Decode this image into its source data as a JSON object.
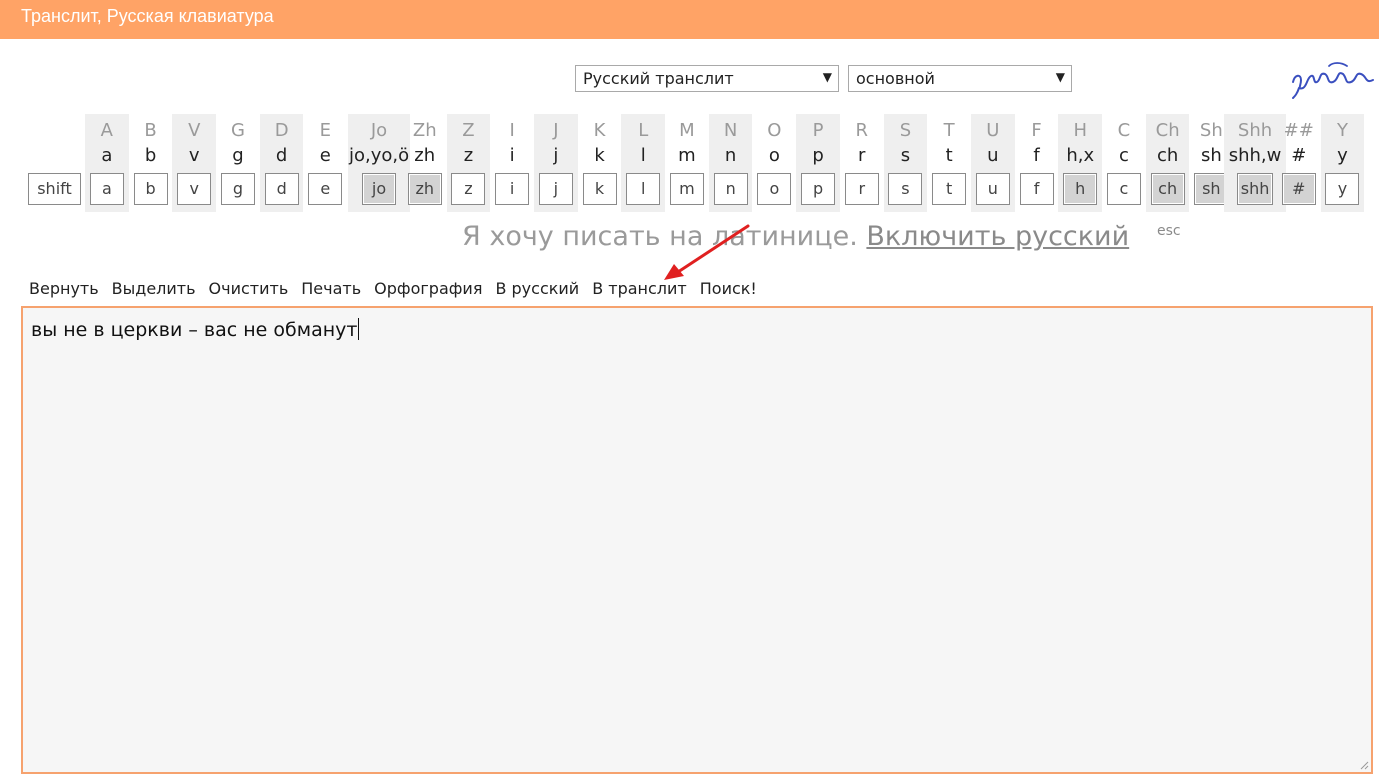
{
  "app": {
    "title": "Транслит, Русская клавиатура"
  },
  "selects": {
    "mode": "Русский транслит",
    "layout": "основной",
    "arrow": "▼"
  },
  "keyboard": {
    "shift_label": "shift",
    "columns": [
      {
        "upper": "A",
        "lower": "a",
        "key": "a",
        "shaded": true,
        "dark": false
      },
      {
        "upper": "B",
        "lower": "b",
        "key": "b",
        "shaded": false,
        "dark": false
      },
      {
        "upper": "V",
        "lower": "v",
        "key": "v",
        "shaded": true,
        "dark": false
      },
      {
        "upper": "G",
        "lower": "g",
        "key": "g",
        "shaded": false,
        "dark": false
      },
      {
        "upper": "D",
        "lower": "d",
        "key": "d",
        "shaded": true,
        "dark": false
      },
      {
        "upper": "E",
        "lower": "e",
        "key": "e",
        "shaded": false,
        "dark": false
      },
      {
        "upper": "Jo",
        "lower": "jo,yo,ö",
        "key": "jo",
        "shaded": true,
        "dark": true
      },
      {
        "upper": "Zh",
        "lower": "zh",
        "key": "zh",
        "shaded": false,
        "dark": true
      },
      {
        "upper": "Z",
        "lower": "z",
        "key": "z",
        "shaded": true,
        "dark": false
      },
      {
        "upper": "I",
        "lower": "i",
        "key": "i",
        "shaded": false,
        "dark": false
      },
      {
        "upper": "J",
        "lower": "j",
        "key": "j",
        "shaded": true,
        "dark": false
      },
      {
        "upper": "K",
        "lower": "k",
        "key": "k",
        "shaded": false,
        "dark": false
      },
      {
        "upper": "L",
        "lower": "l",
        "key": "l",
        "shaded": true,
        "dark": false
      },
      {
        "upper": "M",
        "lower": "m",
        "key": "m",
        "shaded": false,
        "dark": false
      },
      {
        "upper": "N",
        "lower": "n",
        "key": "n",
        "shaded": true,
        "dark": false
      },
      {
        "upper": "O",
        "lower": "o",
        "key": "o",
        "shaded": false,
        "dark": false
      },
      {
        "upper": "P",
        "lower": "p",
        "key": "p",
        "shaded": true,
        "dark": false
      },
      {
        "upper": "R",
        "lower": "r",
        "key": "r",
        "shaded": false,
        "dark": false
      },
      {
        "upper": "S",
        "lower": "s",
        "key": "s",
        "shaded": true,
        "dark": false
      },
      {
        "upper": "T",
        "lower": "t",
        "key": "t",
        "shaded": false,
        "dark": false
      },
      {
        "upper": "U",
        "lower": "u",
        "key": "u",
        "shaded": true,
        "dark": false
      },
      {
        "upper": "F",
        "lower": "f",
        "key": "f",
        "shaded": false,
        "dark": false
      },
      {
        "upper": "H",
        "lower": "h,x",
        "key": "h",
        "shaded": true,
        "dark": true
      },
      {
        "upper": "C",
        "lower": "c",
        "key": "c",
        "shaded": false,
        "dark": false
      },
      {
        "upper": "Ch",
        "lower": "ch",
        "key": "ch",
        "shaded": true,
        "dark": true
      },
      {
        "upper": "Sh",
        "lower": "sh",
        "key": "sh",
        "shaded": false,
        "dark": true
      },
      {
        "upper": "Shh",
        "lower": "shh,w",
        "key": "shh",
        "shaded": true,
        "dark": true
      },
      {
        "upper": "##",
        "lower": "#",
        "key": "#",
        "shaded": false,
        "dark": true
      },
      {
        "upper": "Y",
        "lower": "y",
        "key": "y",
        "shaded": true,
        "dark": false
      }
    ]
  },
  "mode_line": {
    "text": "Я хочу писать на латинице.",
    "link": "Включить русский",
    "esc": "esc"
  },
  "toolbar": {
    "items": [
      "Вернуть",
      "Выделить",
      "Очистить",
      "Печать",
      "Орфография",
      "В русский",
      "В транслит",
      "Поиск!"
    ]
  },
  "editor": {
    "text": "вы не в церкви – вас не обманут"
  },
  "colors": {
    "accent": "#ffa366",
    "annotation_arrow": "#e02020"
  }
}
